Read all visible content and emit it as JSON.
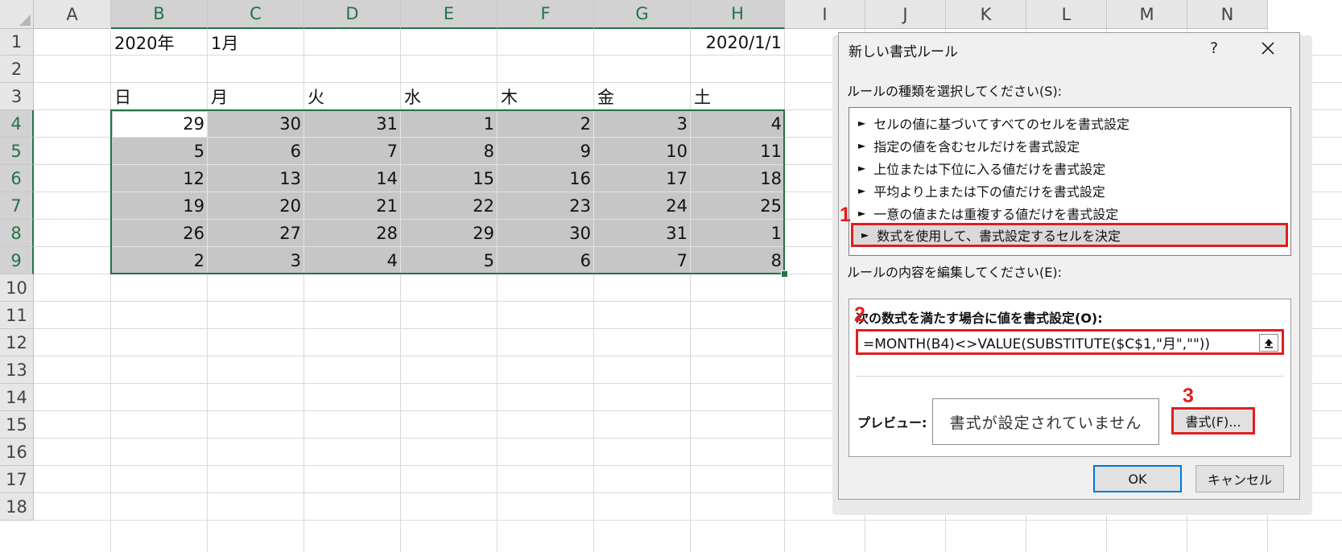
{
  "spreadsheet": {
    "columns": [
      "A",
      "B",
      "C",
      "D",
      "E",
      "F",
      "G",
      "H",
      "I",
      "J",
      "K",
      "L",
      "M",
      "N"
    ],
    "rows": [
      "1",
      "2",
      "3",
      "4",
      "5",
      "6",
      "7",
      "8",
      "9",
      "10",
      "11",
      "12",
      "13",
      "14",
      "15",
      "16",
      "17",
      "18"
    ],
    "selected_columns": [
      "B",
      "C",
      "D",
      "E",
      "F",
      "G",
      "H"
    ],
    "selected_rows": [
      "4",
      "5",
      "6",
      "7",
      "8",
      "9"
    ],
    "row1": {
      "b1": "2020年",
      "c1": "1月",
      "h1": "2020/1/1"
    },
    "weekdays": [
      "日",
      "月",
      "火",
      "水",
      "木",
      "金",
      "土"
    ],
    "calendar": [
      [
        "29",
        "30",
        "31",
        "1",
        "2",
        "3",
        "4"
      ],
      [
        "5",
        "6",
        "7",
        "8",
        "9",
        "10",
        "11"
      ],
      [
        "12",
        "13",
        "14",
        "15",
        "16",
        "17",
        "18"
      ],
      [
        "19",
        "20",
        "21",
        "22",
        "23",
        "24",
        "25"
      ],
      [
        "26",
        "27",
        "28",
        "29",
        "30",
        "31",
        "1"
      ],
      [
        "2",
        "3",
        "4",
        "5",
        "6",
        "7",
        "8"
      ]
    ],
    "selection_fill_color": "#c6c6c6",
    "accent_color": "#217346"
  },
  "dialog": {
    "title": "新しい書式ルール",
    "help": "?",
    "close_icon": "close-icon",
    "rule_type_label": "ルールの種類を選択してください(S):",
    "rule_types": [
      "セルの値に基づいてすべてのセルを書式設定",
      "指定の値を含むセルだけを書式設定",
      "上位または下位に入る値だけを書式設定",
      "平均より上または下の値だけを書式設定",
      "一意の値または重複する値だけを書式設定",
      "数式を使用して、書式設定するセルを決定"
    ],
    "selected_rule_index": 5,
    "edit_label": "ルールの内容を編集してください(E):",
    "formula_label": "次の数式を満たす場合に値を書式設定(O):",
    "formula_value": "=MONTH(B4)<>VALUE(SUBSTITUTE($C$1,\"月\",\"\"))",
    "preview_label": "プレビュー:",
    "preview_text": "書式が設定されていません",
    "format_button": "書式(F)...",
    "ok_button": "OK",
    "cancel_button": "キャンセル",
    "highlight_color": "#e01e1e"
  },
  "annotations": {
    "step1": "1",
    "step2": "2",
    "step3": "3"
  }
}
